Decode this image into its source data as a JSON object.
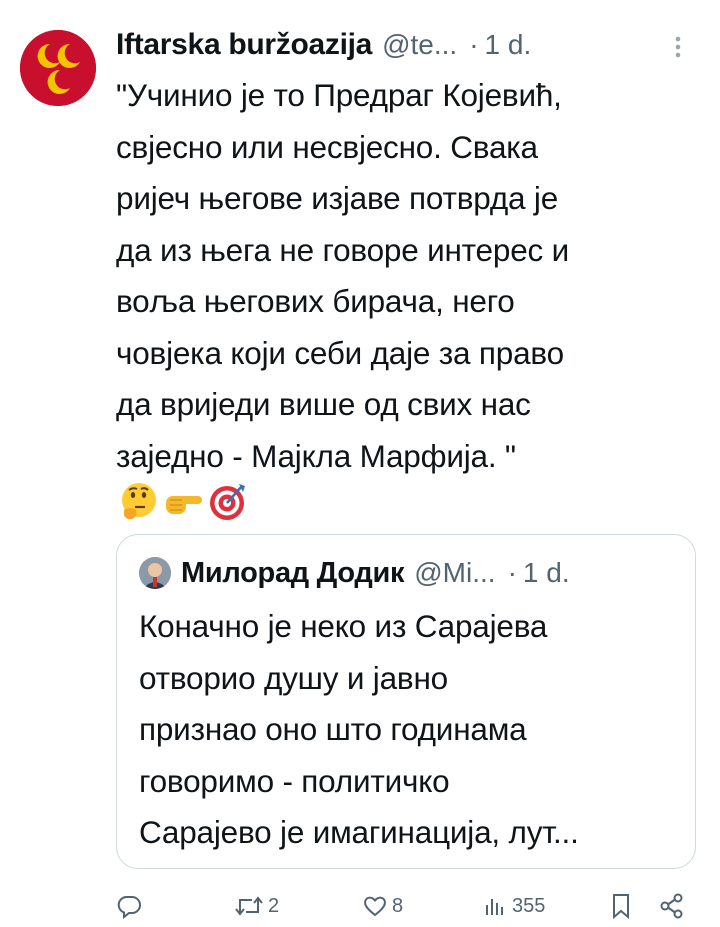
{
  "author": {
    "name": "Iftarska buržoazija",
    "handle": "@te...",
    "dot": "·",
    "time": "1 d."
  },
  "tweet_text": "\"Учинио је то Предраг Којевић,\nсвјесно или несвјесно. Свака\nријеч његове изјаве потврда је\nда из њега не говоре интерес и\nвоља његових бирача, него\nчовјека који себи даје за право\nда вриједи више од свих нас\nзаједно - Мајкла Марфија. \"",
  "emojis": [
    "thinking-face",
    "pointing-right-hand",
    "direct-hit-target"
  ],
  "quoted": {
    "name": "Милорад Додик",
    "handle": "@Mi...",
    "dot": "·",
    "time": "1 d.",
    "text": "Коначно је неко из Сарајева\nотворио душу и јавно\nпризнао оно што годинама\nговоримо - политичко\nСарајево је имагинација, лут..."
  },
  "actions": {
    "replies": "",
    "retweets": "2",
    "likes": "8",
    "views": "355"
  },
  "colors": {
    "text": "#0f1419",
    "muted": "#536471",
    "border": "#cfd9de",
    "avatar_red": "#c8102e",
    "crescent_yellow": "#f5c400"
  }
}
